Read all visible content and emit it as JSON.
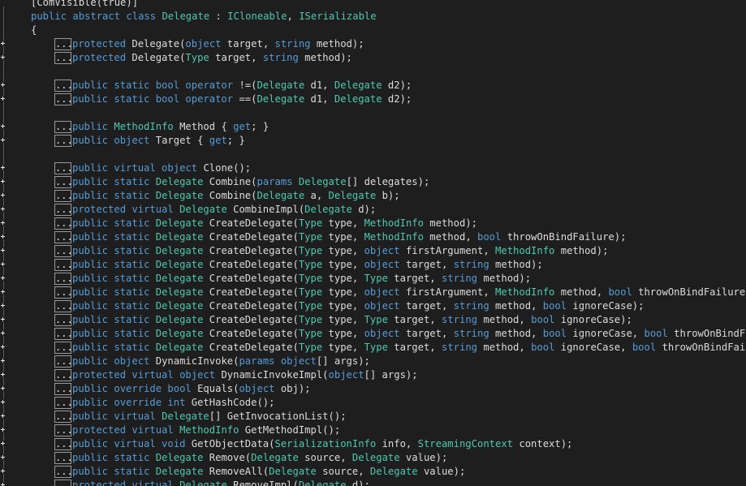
{
  "colors": {
    "background": "#1e1e1e",
    "keyword": "#569cd6",
    "type": "#4ec9b0",
    "text": "#dcdcdc",
    "fold_box": "#9a9a9a"
  },
  "icons": {
    "fold": "expand-plus-icon",
    "collapsed": "collapsed-region-ellipsis"
  },
  "ellipsis_label": "...",
  "lines": [
    {
      "fold": false,
      "ellipsis": false,
      "indent": 0,
      "tokens": [
        {
          "c": "tx",
          "t": "[ComVisible(true)]"
        }
      ]
    },
    {
      "fold": false,
      "ellipsis": false,
      "indent": 0,
      "tokens": [
        {
          "c": "kw",
          "t": "public abstract class "
        },
        {
          "c": "ty",
          "t": "Delegate"
        },
        {
          "c": "tx",
          "t": " : "
        },
        {
          "c": "ty",
          "t": "ICloneable"
        },
        {
          "c": "tx",
          "t": ", "
        },
        {
          "c": "ty",
          "t": "ISerializable"
        }
      ]
    },
    {
      "fold": false,
      "ellipsis": false,
      "indent": 0,
      "tokens": [
        {
          "c": "tx",
          "t": "{"
        }
      ]
    },
    {
      "fold": true,
      "ellipsis": true,
      "indent": 1,
      "tokens": [
        {
          "c": "kw",
          "t": "protected "
        },
        {
          "c": "tx",
          "t": "Delegate("
        },
        {
          "c": "kw",
          "t": "object"
        },
        {
          "c": "tx",
          "t": " target, "
        },
        {
          "c": "kw",
          "t": "string"
        },
        {
          "c": "tx",
          "t": " method);"
        }
      ]
    },
    {
      "fold": true,
      "ellipsis": true,
      "indent": 1,
      "tokens": [
        {
          "c": "kw",
          "t": "protected "
        },
        {
          "c": "tx",
          "t": "Delegate("
        },
        {
          "c": "ty",
          "t": "Type"
        },
        {
          "c": "tx",
          "t": " target, "
        },
        {
          "c": "kw",
          "t": "string"
        },
        {
          "c": "tx",
          "t": " method);"
        }
      ]
    },
    {
      "fold": false,
      "ellipsis": false,
      "indent": 0,
      "tokens": []
    },
    {
      "fold": true,
      "ellipsis": true,
      "indent": 1,
      "tokens": [
        {
          "c": "kw",
          "t": "public static bool operator "
        },
        {
          "c": "tx",
          "t": "!=("
        },
        {
          "c": "ty",
          "t": "Delegate"
        },
        {
          "c": "tx",
          "t": " d1, "
        },
        {
          "c": "ty",
          "t": "Delegate"
        },
        {
          "c": "tx",
          "t": " d2);"
        }
      ]
    },
    {
      "fold": true,
      "ellipsis": true,
      "indent": 1,
      "tokens": [
        {
          "c": "kw",
          "t": "public static bool operator "
        },
        {
          "c": "tx",
          "t": "==("
        },
        {
          "c": "ty",
          "t": "Delegate"
        },
        {
          "c": "tx",
          "t": " d1, "
        },
        {
          "c": "ty",
          "t": "Delegate"
        },
        {
          "c": "tx",
          "t": " d2);"
        }
      ]
    },
    {
      "fold": false,
      "ellipsis": false,
      "indent": 0,
      "tokens": []
    },
    {
      "fold": true,
      "ellipsis": true,
      "indent": 1,
      "tokens": [
        {
          "c": "kw",
          "t": "public "
        },
        {
          "c": "ty",
          "t": "MethodInfo"
        },
        {
          "c": "tx",
          "t": " Method { "
        },
        {
          "c": "kw",
          "t": "get"
        },
        {
          "c": "tx",
          "t": "; }"
        }
      ]
    },
    {
      "fold": true,
      "ellipsis": true,
      "indent": 1,
      "tokens": [
        {
          "c": "kw",
          "t": "public object "
        },
        {
          "c": "tx",
          "t": "Target { "
        },
        {
          "c": "kw",
          "t": "get"
        },
        {
          "c": "tx",
          "t": "; }"
        }
      ]
    },
    {
      "fold": false,
      "ellipsis": false,
      "indent": 0,
      "tokens": []
    },
    {
      "fold": true,
      "ellipsis": true,
      "indent": 1,
      "tokens": [
        {
          "c": "kw",
          "t": "public virtual object "
        },
        {
          "c": "tx",
          "t": "Clone();"
        }
      ]
    },
    {
      "fold": true,
      "ellipsis": true,
      "indent": 1,
      "tokens": [
        {
          "c": "kw",
          "t": "public static "
        },
        {
          "c": "ty",
          "t": "Delegate"
        },
        {
          "c": "tx",
          "t": " Combine("
        },
        {
          "c": "kw",
          "t": "params "
        },
        {
          "c": "ty",
          "t": "Delegate"
        },
        {
          "c": "tx",
          "t": "[] delegates);"
        }
      ]
    },
    {
      "fold": true,
      "ellipsis": true,
      "indent": 1,
      "tokens": [
        {
          "c": "kw",
          "t": "public static "
        },
        {
          "c": "ty",
          "t": "Delegate"
        },
        {
          "c": "tx",
          "t": " Combine("
        },
        {
          "c": "ty",
          "t": "Delegate"
        },
        {
          "c": "tx",
          "t": " a, "
        },
        {
          "c": "ty",
          "t": "Delegate"
        },
        {
          "c": "tx",
          "t": " b);"
        }
      ]
    },
    {
      "fold": true,
      "ellipsis": true,
      "indent": 1,
      "tokens": [
        {
          "c": "kw",
          "t": "protected virtual "
        },
        {
          "c": "ty",
          "t": "Delegate"
        },
        {
          "c": "tx",
          "t": " CombineImpl("
        },
        {
          "c": "ty",
          "t": "Delegate"
        },
        {
          "c": "tx",
          "t": " d);"
        }
      ]
    },
    {
      "fold": true,
      "ellipsis": true,
      "indent": 1,
      "tokens": [
        {
          "c": "kw",
          "t": "public static "
        },
        {
          "c": "ty",
          "t": "Delegate"
        },
        {
          "c": "tx",
          "t": " CreateDelegate("
        },
        {
          "c": "ty",
          "t": "Type"
        },
        {
          "c": "tx",
          "t": " type, "
        },
        {
          "c": "ty",
          "t": "MethodInfo"
        },
        {
          "c": "tx",
          "t": " method);"
        }
      ]
    },
    {
      "fold": true,
      "ellipsis": true,
      "indent": 1,
      "tokens": [
        {
          "c": "kw",
          "t": "public static "
        },
        {
          "c": "ty",
          "t": "Delegate"
        },
        {
          "c": "tx",
          "t": " CreateDelegate("
        },
        {
          "c": "ty",
          "t": "Type"
        },
        {
          "c": "tx",
          "t": " type, "
        },
        {
          "c": "ty",
          "t": "MethodInfo"
        },
        {
          "c": "tx",
          "t": " method, "
        },
        {
          "c": "kw",
          "t": "bool"
        },
        {
          "c": "tx",
          "t": " throwOnBindFailure);"
        }
      ]
    },
    {
      "fold": true,
      "ellipsis": true,
      "indent": 1,
      "tokens": [
        {
          "c": "kw",
          "t": "public static "
        },
        {
          "c": "ty",
          "t": "Delegate"
        },
        {
          "c": "tx",
          "t": " CreateDelegate("
        },
        {
          "c": "ty",
          "t": "Type"
        },
        {
          "c": "tx",
          "t": " type, "
        },
        {
          "c": "kw",
          "t": "object"
        },
        {
          "c": "tx",
          "t": " firstArgument, "
        },
        {
          "c": "ty",
          "t": "MethodInfo"
        },
        {
          "c": "tx",
          "t": " method);"
        }
      ]
    },
    {
      "fold": true,
      "ellipsis": true,
      "indent": 1,
      "tokens": [
        {
          "c": "kw",
          "t": "public static "
        },
        {
          "c": "ty",
          "t": "Delegate"
        },
        {
          "c": "tx",
          "t": " CreateDelegate("
        },
        {
          "c": "ty",
          "t": "Type"
        },
        {
          "c": "tx",
          "t": " type, "
        },
        {
          "c": "kw",
          "t": "object"
        },
        {
          "c": "tx",
          "t": " target, "
        },
        {
          "c": "kw",
          "t": "string"
        },
        {
          "c": "tx",
          "t": " method);"
        }
      ]
    },
    {
      "fold": true,
      "ellipsis": true,
      "indent": 1,
      "tokens": [
        {
          "c": "kw",
          "t": "public static "
        },
        {
          "c": "ty",
          "t": "Delegate"
        },
        {
          "c": "tx",
          "t": " CreateDelegate("
        },
        {
          "c": "ty",
          "t": "Type"
        },
        {
          "c": "tx",
          "t": " type, "
        },
        {
          "c": "ty",
          "t": "Type"
        },
        {
          "c": "tx",
          "t": " target, "
        },
        {
          "c": "kw",
          "t": "string"
        },
        {
          "c": "tx",
          "t": " method);"
        }
      ]
    },
    {
      "fold": true,
      "ellipsis": true,
      "indent": 1,
      "tokens": [
        {
          "c": "kw",
          "t": "public static "
        },
        {
          "c": "ty",
          "t": "Delegate"
        },
        {
          "c": "tx",
          "t": " CreateDelegate("
        },
        {
          "c": "ty",
          "t": "Type"
        },
        {
          "c": "tx",
          "t": " type, "
        },
        {
          "c": "kw",
          "t": "object"
        },
        {
          "c": "tx",
          "t": " firstArgument, "
        },
        {
          "c": "ty",
          "t": "MethodInfo"
        },
        {
          "c": "tx",
          "t": " method, "
        },
        {
          "c": "kw",
          "t": "bool"
        },
        {
          "c": "tx",
          "t": " throwOnBindFailure);"
        }
      ]
    },
    {
      "fold": true,
      "ellipsis": true,
      "indent": 1,
      "tokens": [
        {
          "c": "kw",
          "t": "public static "
        },
        {
          "c": "ty",
          "t": "Delegate"
        },
        {
          "c": "tx",
          "t": " CreateDelegate("
        },
        {
          "c": "ty",
          "t": "Type"
        },
        {
          "c": "tx",
          "t": " type, "
        },
        {
          "c": "kw",
          "t": "object"
        },
        {
          "c": "tx",
          "t": " target, "
        },
        {
          "c": "kw",
          "t": "string"
        },
        {
          "c": "tx",
          "t": " method, "
        },
        {
          "c": "kw",
          "t": "bool"
        },
        {
          "c": "tx",
          "t": " ignoreCase);"
        }
      ]
    },
    {
      "fold": true,
      "ellipsis": true,
      "indent": 1,
      "tokens": [
        {
          "c": "kw",
          "t": "public static "
        },
        {
          "c": "ty",
          "t": "Delegate"
        },
        {
          "c": "tx",
          "t": " CreateDelegate("
        },
        {
          "c": "ty",
          "t": "Type"
        },
        {
          "c": "tx",
          "t": " type, "
        },
        {
          "c": "ty",
          "t": "Type"
        },
        {
          "c": "tx",
          "t": " target, "
        },
        {
          "c": "kw",
          "t": "string"
        },
        {
          "c": "tx",
          "t": " method, "
        },
        {
          "c": "kw",
          "t": "bool"
        },
        {
          "c": "tx",
          "t": " ignoreCase);"
        }
      ]
    },
    {
      "fold": true,
      "ellipsis": true,
      "indent": 1,
      "tokens": [
        {
          "c": "kw",
          "t": "public static "
        },
        {
          "c": "ty",
          "t": "Delegate"
        },
        {
          "c": "tx",
          "t": " CreateDelegate("
        },
        {
          "c": "ty",
          "t": "Type"
        },
        {
          "c": "tx",
          "t": " type, "
        },
        {
          "c": "kw",
          "t": "object"
        },
        {
          "c": "tx",
          "t": " target, "
        },
        {
          "c": "kw",
          "t": "string"
        },
        {
          "c": "tx",
          "t": " method, "
        },
        {
          "c": "kw",
          "t": "bool"
        },
        {
          "c": "tx",
          "t": " ignoreCase, "
        },
        {
          "c": "kw",
          "t": "bool"
        },
        {
          "c": "tx",
          "t": " throwOnBindFailure"
        }
      ]
    },
    {
      "fold": true,
      "ellipsis": true,
      "indent": 1,
      "tokens": [
        {
          "c": "kw",
          "t": "public static "
        },
        {
          "c": "ty",
          "t": "Delegate"
        },
        {
          "c": "tx",
          "t": " CreateDelegate("
        },
        {
          "c": "ty",
          "t": "Type"
        },
        {
          "c": "tx",
          "t": " type, "
        },
        {
          "c": "ty",
          "t": "Type"
        },
        {
          "c": "tx",
          "t": " target, "
        },
        {
          "c": "kw",
          "t": "string"
        },
        {
          "c": "tx",
          "t": " method, "
        },
        {
          "c": "kw",
          "t": "bool"
        },
        {
          "c": "tx",
          "t": " ignoreCase, "
        },
        {
          "c": "kw",
          "t": "bool"
        },
        {
          "c": "tx",
          "t": " throwOnBindFailure);"
        }
      ]
    },
    {
      "fold": true,
      "ellipsis": true,
      "indent": 1,
      "tokens": [
        {
          "c": "kw",
          "t": "public object "
        },
        {
          "c": "tx",
          "t": "DynamicInvoke("
        },
        {
          "c": "kw",
          "t": "params object"
        },
        {
          "c": "tx",
          "t": "[] args);"
        }
      ]
    },
    {
      "fold": true,
      "ellipsis": true,
      "indent": 1,
      "tokens": [
        {
          "c": "kw",
          "t": "protected virtual object "
        },
        {
          "c": "tx",
          "t": "DynamicInvokeImpl("
        },
        {
          "c": "kw",
          "t": "object"
        },
        {
          "c": "tx",
          "t": "[] args);"
        }
      ]
    },
    {
      "fold": true,
      "ellipsis": true,
      "indent": 1,
      "tokens": [
        {
          "c": "kw",
          "t": "public override bool "
        },
        {
          "c": "tx",
          "t": "Equals("
        },
        {
          "c": "kw",
          "t": "object"
        },
        {
          "c": "tx",
          "t": " obj);"
        }
      ]
    },
    {
      "fold": true,
      "ellipsis": true,
      "indent": 1,
      "tokens": [
        {
          "c": "kw",
          "t": "public override int "
        },
        {
          "c": "tx",
          "t": "GetHashCode();"
        }
      ]
    },
    {
      "fold": true,
      "ellipsis": true,
      "indent": 1,
      "tokens": [
        {
          "c": "kw",
          "t": "public virtual "
        },
        {
          "c": "ty",
          "t": "Delegate"
        },
        {
          "c": "tx",
          "t": "[] GetInvocationList();"
        }
      ]
    },
    {
      "fold": true,
      "ellipsis": true,
      "indent": 1,
      "tokens": [
        {
          "c": "kw",
          "t": "protected virtual "
        },
        {
          "c": "ty",
          "t": "MethodInfo"
        },
        {
          "c": "tx",
          "t": " GetMethodImpl();"
        }
      ]
    },
    {
      "fold": true,
      "ellipsis": true,
      "indent": 1,
      "tokens": [
        {
          "c": "kw",
          "t": "public virtual void "
        },
        {
          "c": "tx",
          "t": "GetObjectData("
        },
        {
          "c": "ty",
          "t": "SerializationInfo"
        },
        {
          "c": "tx",
          "t": " info, "
        },
        {
          "c": "ty",
          "t": "StreamingContext"
        },
        {
          "c": "tx",
          "t": " context);"
        }
      ]
    },
    {
      "fold": true,
      "ellipsis": true,
      "indent": 1,
      "tokens": [
        {
          "c": "kw",
          "t": "public static "
        },
        {
          "c": "ty",
          "t": "Delegate"
        },
        {
          "c": "tx",
          "t": " Remove("
        },
        {
          "c": "ty",
          "t": "Delegate"
        },
        {
          "c": "tx",
          "t": " source, "
        },
        {
          "c": "ty",
          "t": "Delegate"
        },
        {
          "c": "tx",
          "t": " value);"
        }
      ]
    },
    {
      "fold": true,
      "ellipsis": true,
      "indent": 1,
      "tokens": [
        {
          "c": "kw",
          "t": "public static "
        },
        {
          "c": "ty",
          "t": "Delegate"
        },
        {
          "c": "tx",
          "t": " RemoveAll("
        },
        {
          "c": "ty",
          "t": "Delegate"
        },
        {
          "c": "tx",
          "t": " source, "
        },
        {
          "c": "ty",
          "t": "Delegate"
        },
        {
          "c": "tx",
          "t": " value);"
        }
      ]
    },
    {
      "fold": true,
      "ellipsis": true,
      "indent": 1,
      "tokens": [
        {
          "c": "kw",
          "t": "protected virtual "
        },
        {
          "c": "ty",
          "t": "Delegate"
        },
        {
          "c": "tx",
          "t": " RemoveImpl("
        },
        {
          "c": "ty",
          "t": "Delegate"
        },
        {
          "c": "tx",
          "t": " d);"
        }
      ]
    },
    {
      "fold": false,
      "ellipsis": false,
      "indent": 0,
      "tokens": [
        {
          "c": "tx",
          "t": "}"
        }
      ]
    }
  ]
}
